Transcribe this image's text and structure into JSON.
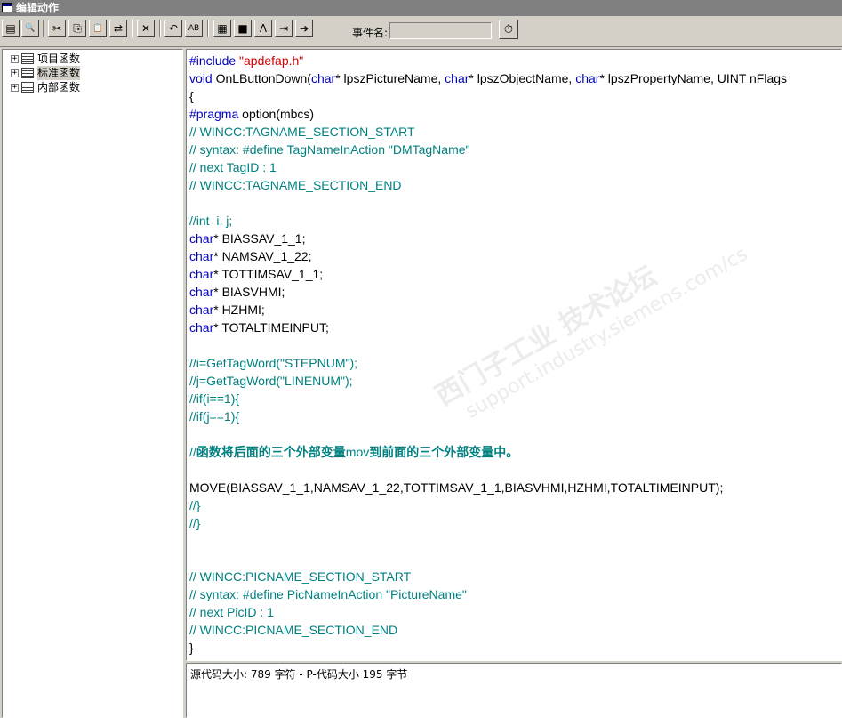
{
  "window": {
    "title": "编辑动作"
  },
  "toolbar": {
    "buttons": [
      {
        "icon": "compile-icon",
        "glyph": "▤"
      },
      {
        "icon": "find-icon",
        "glyph": "🔍"
      },
      {
        "icon": "cut-icon",
        "glyph": "✂"
      },
      {
        "icon": "copy-icon",
        "glyph": "⎘"
      },
      {
        "icon": "paste-icon",
        "glyph": "📋"
      },
      {
        "icon": "replace-icon",
        "glyph": "⇄"
      },
      {
        "icon": "delete-icon",
        "glyph": "✕"
      },
      {
        "icon": "undo-icon",
        "glyph": "↶"
      },
      {
        "icon": "abc-icon",
        "glyph": "AB"
      },
      {
        "icon": "tag-select-icon",
        "glyph": "▦"
      },
      {
        "icon": "object-browser-icon",
        "glyph": "■"
      },
      {
        "icon": "properties-icon",
        "glyph": "Ʌ"
      },
      {
        "icon": "import-icon",
        "glyph": "⇥"
      },
      {
        "icon": "export-icon",
        "glyph": "➔"
      }
    ],
    "event_label": "事件名:",
    "event_value": "",
    "event_button_icon": "trigger-clock-icon",
    "event_button_glyph": "⏱"
  },
  "tree": {
    "items": [
      {
        "label": "项目函数",
        "icon": "library-icon",
        "expander": "+",
        "selected": false
      },
      {
        "label": "标准函数",
        "icon": "library-icon",
        "expander": "+",
        "selected": true
      },
      {
        "label": "内部函数",
        "icon": "library-icon",
        "expander": "+",
        "selected": false
      }
    ]
  },
  "code": {
    "lines": [
      [
        {
          "t": "#include ",
          "c": "kw"
        },
        {
          "t": "\"apdefap.h\"",
          "c": "str"
        }
      ],
      [
        {
          "t": "void",
          "c": "kw"
        },
        {
          "t": " OnLButtonDown(",
          "c": "plain"
        },
        {
          "t": "char",
          "c": "kw"
        },
        {
          "t": "* lpszPictureName, ",
          "c": "plain"
        },
        {
          "t": "char",
          "c": "kw"
        },
        {
          "t": "* lpszObjectName, ",
          "c": "plain"
        },
        {
          "t": "char",
          "c": "kw"
        },
        {
          "t": "* lpszPropertyName, UINT nFlags",
          "c": "plain"
        }
      ],
      [
        {
          "t": "{",
          "c": "plain"
        }
      ],
      [
        {
          "t": "#pragma",
          "c": "kw"
        },
        {
          "t": " option(mbcs)",
          "c": "plain"
        }
      ],
      [
        {
          "t": "// WINCC:TAGNAME_SECTION_START",
          "c": "cmt"
        }
      ],
      [
        {
          "t": "// syntax: #define TagNameInAction \"DMTagName\"",
          "c": "cmt"
        }
      ],
      [
        {
          "t": "// next TagID : 1",
          "c": "cmt"
        }
      ],
      [
        {
          "t": "// WINCC:TAGNAME_SECTION_END",
          "c": "cmt"
        }
      ],
      [
        {
          "t": "",
          "c": "plain"
        }
      ],
      [
        {
          "t": "//int  i, j;",
          "c": "cmt"
        }
      ],
      [
        {
          "t": "char",
          "c": "kw"
        },
        {
          "t": "* BIASSAV_1_1;",
          "c": "plain"
        }
      ],
      [
        {
          "t": "char",
          "c": "kw"
        },
        {
          "t": "* NAMSAV_1_22;",
          "c": "plain"
        }
      ],
      [
        {
          "t": "char",
          "c": "kw"
        },
        {
          "t": "* TOTTIMSAV_1_1;",
          "c": "plain"
        }
      ],
      [
        {
          "t": "char",
          "c": "kw"
        },
        {
          "t": "* BIASVHMI;",
          "c": "plain"
        }
      ],
      [
        {
          "t": "char",
          "c": "kw"
        },
        {
          "t": "* HZHMI;",
          "c": "plain"
        }
      ],
      [
        {
          "t": "char",
          "c": "kw"
        },
        {
          "t": "* TOTALTIMEINPUT;",
          "c": "plain"
        }
      ],
      [
        {
          "t": "",
          "c": "plain"
        }
      ],
      [
        {
          "t": "//i=GetTagWord(\"STEPNUM\");",
          "c": "cmt"
        }
      ],
      [
        {
          "t": "//j=GetTagWord(\"LINENUM\");",
          "c": "cmt"
        }
      ],
      [
        {
          "t": "//if(i==1){",
          "c": "cmt"
        }
      ],
      [
        {
          "t": "//if(j==1){",
          "c": "cmt"
        }
      ],
      [
        {
          "t": "",
          "c": "plain"
        }
      ],
      [
        {
          "t": "//",
          "c": "cmt"
        },
        {
          "t": "函数将后面的三个外部变量",
          "c": "cmt bold"
        },
        {
          "t": "mov",
          "c": "cmt"
        },
        {
          "t": "到前面的三个外部变量中。",
          "c": "cmt bold"
        }
      ],
      [
        {
          "t": "",
          "c": "plain"
        }
      ],
      [
        {
          "t": "MOVE(BIASSAV_1_1,NAMSAV_1_22,TOTTIMSAV_1_1,BIASVHMI,HZHMI,TOTALTIMEINPUT);",
          "c": "plain"
        }
      ],
      [
        {
          "t": "//}",
          "c": "cmt"
        }
      ],
      [
        {
          "t": "//}",
          "c": "cmt"
        }
      ],
      [
        {
          "t": "",
          "c": "plain"
        }
      ],
      [
        {
          "t": "",
          "c": "plain"
        }
      ],
      [
        {
          "t": "// WINCC:PICNAME_SECTION_START",
          "c": "cmt"
        }
      ],
      [
        {
          "t": "// syntax: #define PicNameInAction \"PictureName\"",
          "c": "cmt"
        }
      ],
      [
        {
          "t": "// next PicID : 1",
          "c": "cmt"
        }
      ],
      [
        {
          "t": "// WINCC:PICNAME_SECTION_END",
          "c": "cmt"
        }
      ],
      [
        {
          "t": "}",
          "c": "plain"
        }
      ]
    ]
  },
  "status": {
    "text": "源代码大小: 789 字符 - P-代码大小 195 字节"
  },
  "watermark": {
    "text": "西门子工业 技术论坛",
    "url": "support.industry.siemens.com/cs"
  }
}
